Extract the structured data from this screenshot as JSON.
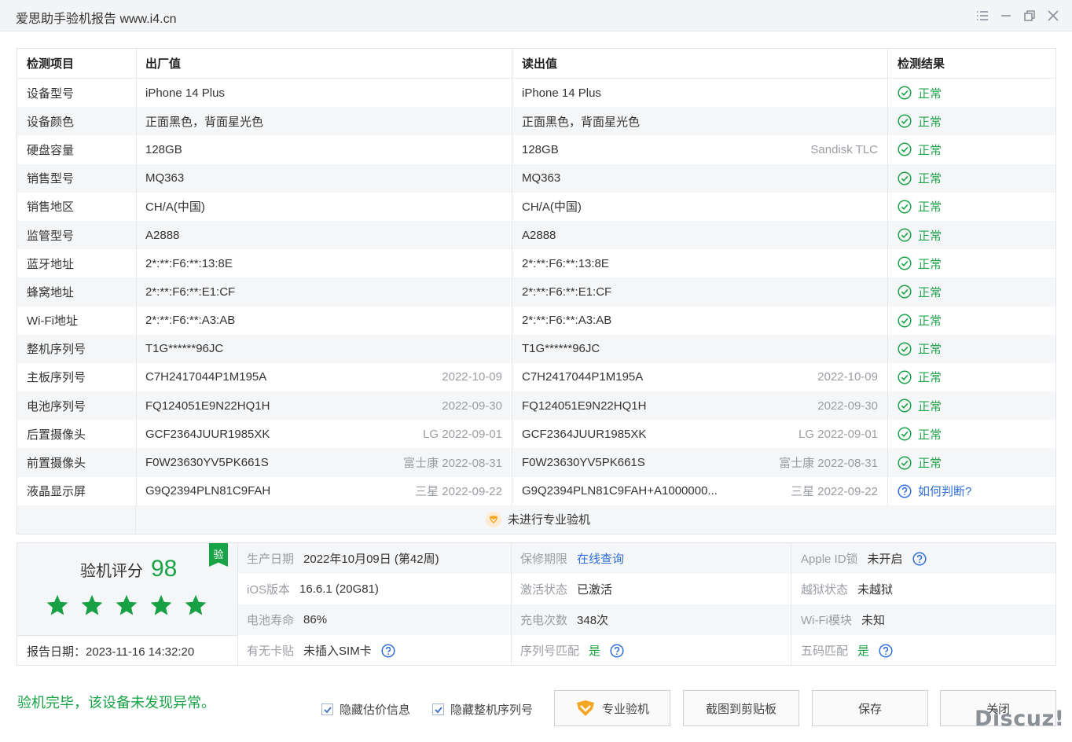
{
  "window": {
    "title": "爱思助手验机报告 www.i4.cn"
  },
  "table": {
    "headers": [
      "检测项目",
      "出厂值",
      "读出值",
      "检测结果"
    ],
    "rows": [
      {
        "item": "设备型号",
        "factory": "iPhone 14 Plus",
        "factory_sub": "",
        "read": "iPhone 14 Plus",
        "read_sub": "",
        "result": "正常"
      },
      {
        "item": "设备颜色",
        "factory": "正面黑色，背面星光色",
        "factory_sub": "",
        "read": "正面黑色，背面星光色",
        "read_sub": "",
        "result": "正常"
      },
      {
        "item": "硬盘容量",
        "factory": "128GB",
        "factory_sub": "",
        "read": "128GB",
        "read_sub": "Sandisk TLC",
        "result": "正常"
      },
      {
        "item": "销售型号",
        "factory": "MQ363",
        "factory_sub": "",
        "read": "MQ363",
        "read_sub": "",
        "result": "正常"
      },
      {
        "item": "销售地区",
        "factory": "CH/A(中国)",
        "factory_sub": "",
        "read": "CH/A(中国)",
        "read_sub": "",
        "result": "正常"
      },
      {
        "item": "监管型号",
        "factory": "A2888",
        "factory_sub": "",
        "read": "A2888",
        "read_sub": "",
        "result": "正常"
      },
      {
        "item": "蓝牙地址",
        "factory": "2*:**:F6:**:13:8E",
        "factory_sub": "",
        "read": "2*:**:F6:**:13:8E",
        "read_sub": "",
        "result": "正常"
      },
      {
        "item": "蜂窝地址",
        "factory": "2*:**:F6:**:E1:CF",
        "factory_sub": "",
        "read": "2*:**:F6:**:E1:CF",
        "read_sub": "",
        "result": "正常"
      },
      {
        "item": "Wi-Fi地址",
        "factory": "2*:**:F6:**:A3:AB",
        "factory_sub": "",
        "read": "2*:**:F6:**:A3:AB",
        "read_sub": "",
        "result": "正常"
      },
      {
        "item": "整机序列号",
        "factory": "T1G******96JC",
        "factory_sub": "",
        "read": "T1G******96JC",
        "read_sub": "",
        "result": "正常"
      },
      {
        "item": "主板序列号",
        "factory": "C7H2417044P1M195A",
        "factory_sub": "2022-10-09",
        "read": "C7H2417044P1M195A",
        "read_sub": "2022-10-09",
        "result": "正常"
      },
      {
        "item": "电池序列号",
        "factory": "FQ124051E9N22HQ1H",
        "factory_sub": "2022-09-30",
        "read": "FQ124051E9N22HQ1H",
        "read_sub": "2022-09-30",
        "result": "正常"
      },
      {
        "item": "后置摄像头",
        "factory": "GCF2364JUUR1985XK",
        "factory_sub": "LG 2022-09-01",
        "read": "GCF2364JUUR1985XK",
        "read_sub": "LG 2022-09-01",
        "result": "正常"
      },
      {
        "item": "前置摄像头",
        "factory": "F0W23630YV5PK661S",
        "factory_sub": "富士康 2022-08-31",
        "read": "F0W23630YV5PK661S",
        "read_sub": "富士康 2022-08-31",
        "result": "正常"
      },
      {
        "item": "液晶显示屏",
        "factory": "G9Q2394PLN81C9FAH",
        "factory_sub": "三星 2022-09-22",
        "read": "G9Q2394PLN81C9FAH+A1000000...",
        "read_sub": "三星 2022-09-22",
        "result": "如何判断?"
      }
    ],
    "pro_notice": "未进行专业验机"
  },
  "summary": {
    "score_label": "验机评分",
    "score": "98",
    "stars": 5,
    "badge": "验",
    "report_date": "报告日期：2023-11-16 14:32:20",
    "info": [
      [
        {
          "label": "生产日期",
          "value": "2022年10月09日 (第42周)"
        },
        {
          "label": "保修期限",
          "value": "在线查询"
        },
        {
          "label": "Apple ID锁",
          "value": "未开启"
        }
      ],
      [
        {
          "label": "iOS版本",
          "value": "16.6.1 (20G81)"
        },
        {
          "label": "激活状态",
          "value": "已激活"
        },
        {
          "label": "越狱状态",
          "value": "未越狱"
        }
      ],
      [
        {
          "label": "电池寿命",
          "value": "86%"
        },
        {
          "label": "充电次数",
          "value": "348次"
        },
        {
          "label": "Wi-Fi模块",
          "value": "未知"
        }
      ],
      [
        {
          "label": "有无卡贴",
          "value": "未插入SIM卡"
        },
        {
          "label": "序列号匹配",
          "value": "是"
        },
        {
          "label": "五码匹配",
          "value": "是"
        }
      ]
    ]
  },
  "footer": {
    "status_message": "验机完毕，该设备未发现异常。",
    "checkbox_hide_price": "隐藏估价信息",
    "checkbox_hide_serial": "隐藏整机序列号",
    "btn_pro": "专业验机",
    "btn_screenshot": "截图到剪贴板",
    "btn_save": "保存",
    "btn_close": "关闭",
    "watermark": "Discuz!"
  },
  "colors": {
    "ok_green": "#19a347",
    "link_blue": "#2f6fd8",
    "muted_gray": "#9a9da3",
    "pro_orange": "#f5a623"
  }
}
